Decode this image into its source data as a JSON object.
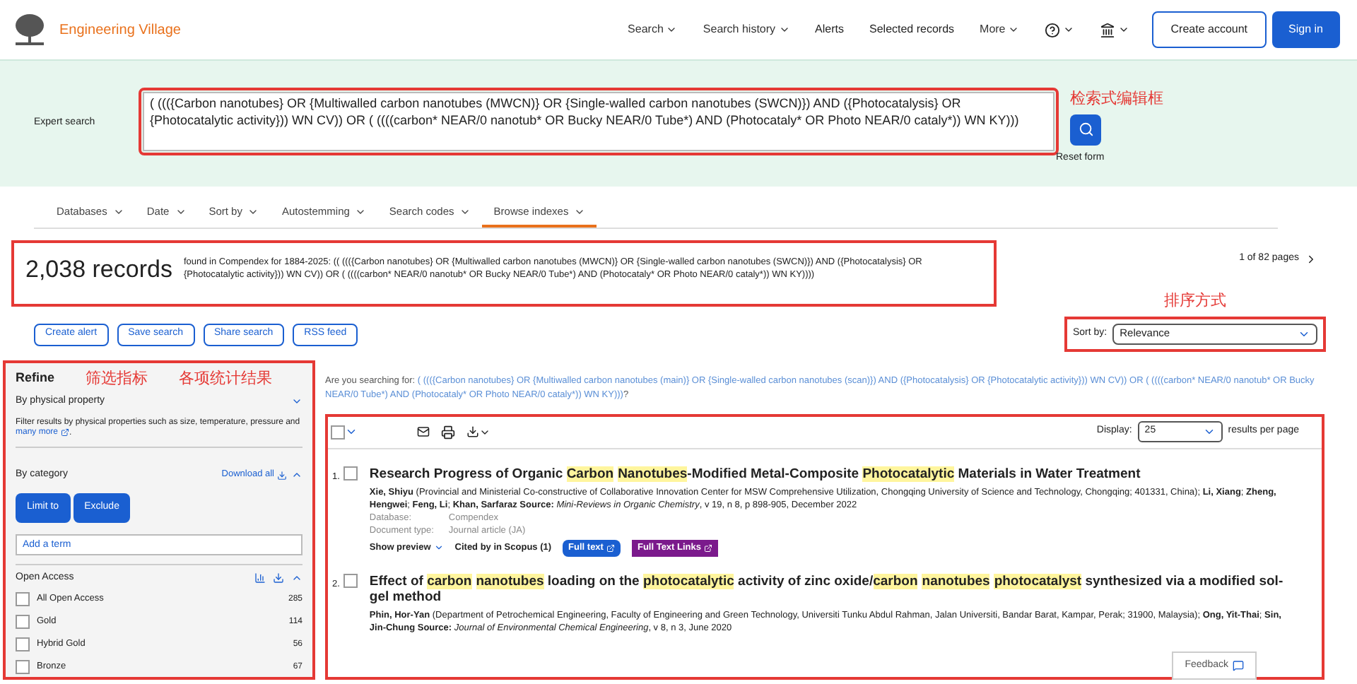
{
  "brand": "Engineering Village",
  "nav": [
    {
      "label": "Search",
      "kind": "menu"
    },
    {
      "label": "Search history",
      "kind": "menu"
    },
    {
      "label": "Alerts",
      "kind": "link"
    },
    {
      "label": "Selected records",
      "kind": "link"
    },
    {
      "label": "More",
      "kind": "menu"
    },
    {
      "kind": "help"
    },
    {
      "kind": "institution"
    }
  ],
  "account_buttons": [
    "Create account",
    "Sign in"
  ],
  "search": {
    "label": "Expert search",
    "value": "( ((({Carbon nanotubes} OR {Multiwalled carbon nanotubes (MWCN)} OR {Single-walled carbon nanotubes (SWCN)}) AND ({Photocatalysis} OR {Photocatalytic activity})) WN CV)) OR ( ((((carbon* NEAR/0 nanotub* OR Bucky NEAR/0 Tube*) AND (Photocataly* OR Photo NEAR/0 cataly*)) WN KY)))",
    "reset": "Reset form"
  },
  "annotations": [
    "检索式编辑框",
    "排序方式",
    "筛选指标",
    "各项统计结果"
  ],
  "tabs": [
    {
      "label": "Databases",
      "selected": false
    },
    {
      "label": "Date",
      "selected": false
    },
    {
      "label": "Sort by",
      "selected": false
    },
    {
      "label": "Autostemming",
      "selected": false
    },
    {
      "label": "Search codes",
      "selected": false
    },
    {
      "label": "Browse indexes",
      "selected": true
    }
  ],
  "summary": {
    "count": "2,038 records",
    "description": "found in Compendex for 1884-2025: (( ((({Carbon nanotubes} OR {Multiwalled carbon nanotubes (MWCN)} OR {Single-walled carbon nanotubes (SWCN)}) AND ({Photocatalysis} OR {Photocatalytic activity})) WN CV)) OR ( ((((carbon* NEAR/0 nanotub* OR Bucky NEAR/0 Tube*) AND (Photocataly* OR Photo NEAR/0 cataly*)) WN KY))))",
    "pages": "1 of 82 pages"
  },
  "actions": [
    "Create alert",
    "Save search",
    "Share search",
    "RSS feed"
  ],
  "sort": {
    "label": "Sort by:",
    "value": "Relevance"
  },
  "refine": {
    "title": "Refine",
    "physical": {
      "title": "By physical property",
      "text": "Filter results by physical properties such as size, temperature, pressure and",
      "link": "many more",
      "end": "."
    },
    "category": {
      "title": "By category",
      "download": "Download all",
      "buttons": [
        "Limit to",
        "Exclude"
      ],
      "placeholder": "Add a term"
    },
    "facet": {
      "title": "Open Access",
      "items": [
        {
          "label": "All Open Access",
          "count": "285",
          "checked": false
        },
        {
          "label": "Gold",
          "count": "114",
          "checked": false
        },
        {
          "label": "Hybrid Gold",
          "count": "56",
          "checked": false
        },
        {
          "label": "Bronze",
          "count": "67",
          "checked": false
        }
      ]
    }
  },
  "suggestion": {
    "label": "Are you searching for:",
    "query": "( ((({Carbon nanotubes} OR {Multiwalled carbon nanotubes (main)} OR {Single-walled carbon nanotubes (scan)}) AND ({Photocatalysis} OR {Photocatalytic activity})) WN CV)) OR ( ((((carbon* NEAR/0 nanotub* OR Bucky NEAR/0 Tube*) AND (Photocataly* OR Photo NEAR/0 cataly*)) WN KY)))",
    "end": "?"
  },
  "select_all": {
    "checked": false
  },
  "display": {
    "label": "Display:",
    "value": "25",
    "suffix": "results per page"
  },
  "results": [
    {
      "number": "1.",
      "checked": false,
      "title": [
        {
          "text": "Research Progress of Organic ",
          "highlight": false
        },
        {
          "text": "Carbon",
          "highlight": true
        },
        {
          "text": "Nanotubes",
          "highlight": true
        },
        {
          "text": "-Modified Metal-Composite ",
          "highlight": false
        },
        {
          "text": "Photocatalytic",
          "highlight": true
        },
        {
          "text": " Materials in Water Treatment",
          "highlight": false
        }
      ],
      "authors": "**Xie, Shiyu** (Provincial and Ministerial Co-constructive of Collaborative Innovation Center for MSW Comprehensive Utilization, Chongqing University of Science and Technology, Chongqing; 401331, China); **Li, Xiang**; **Zheng, Hengwei**; **Feng, Li**; **Khan, Sarfaraz** **Source:** *Mini-Reviews in Organic Chemistry*, v 19, n 8, p 898-905, December 2022",
      "meta": [
        {
          "label": "Database:",
          "value": "Compendex"
        },
        {
          "label": "Document type:",
          "value": "Journal article (JA)"
        }
      ],
      "preview": "Show preview",
      "cited": "Cited by in Scopus (1)",
      "links": [
        "Full text",
        "Full Text Links"
      ]
    },
    {
      "number": "2.",
      "checked": false,
      "title": [
        {
          "text": "Effect of ",
          "highlight": false
        },
        {
          "text": "carbon",
          "highlight": true
        },
        {
          "text": "nanotubes",
          "highlight": true
        },
        {
          "text": " loading on the ",
          "highlight": false
        },
        {
          "text": "photocatalytic",
          "highlight": true
        },
        {
          "text": " activity of zinc oxide/",
          "highlight": false
        },
        {
          "text": "carbon",
          "highlight": true
        },
        {
          "text": "nanotubes",
          "highlight": true
        },
        {
          "text": "photocatalyst",
          "highlight": true
        },
        {
          "text": " synthesized via a modified sol-gel method",
          "highlight": false
        }
      ],
      "authors": "**Phin, Hor-Yan** (Department of Petrochemical Engineering, Faculty of Engineering and Green Technology, Universiti Tunku Abdul Rahman, Jalan Universiti, Bandar Barat, Kampar, Perak; 31900, Malaysia); **Ong, Yit-Thai**; **Sin, Jin-Chung** **Source:** *Journal of Environmental Chemical Engineering*, v 8, n 3, June 2020"
    }
  ],
  "feedback": "Feedback"
}
